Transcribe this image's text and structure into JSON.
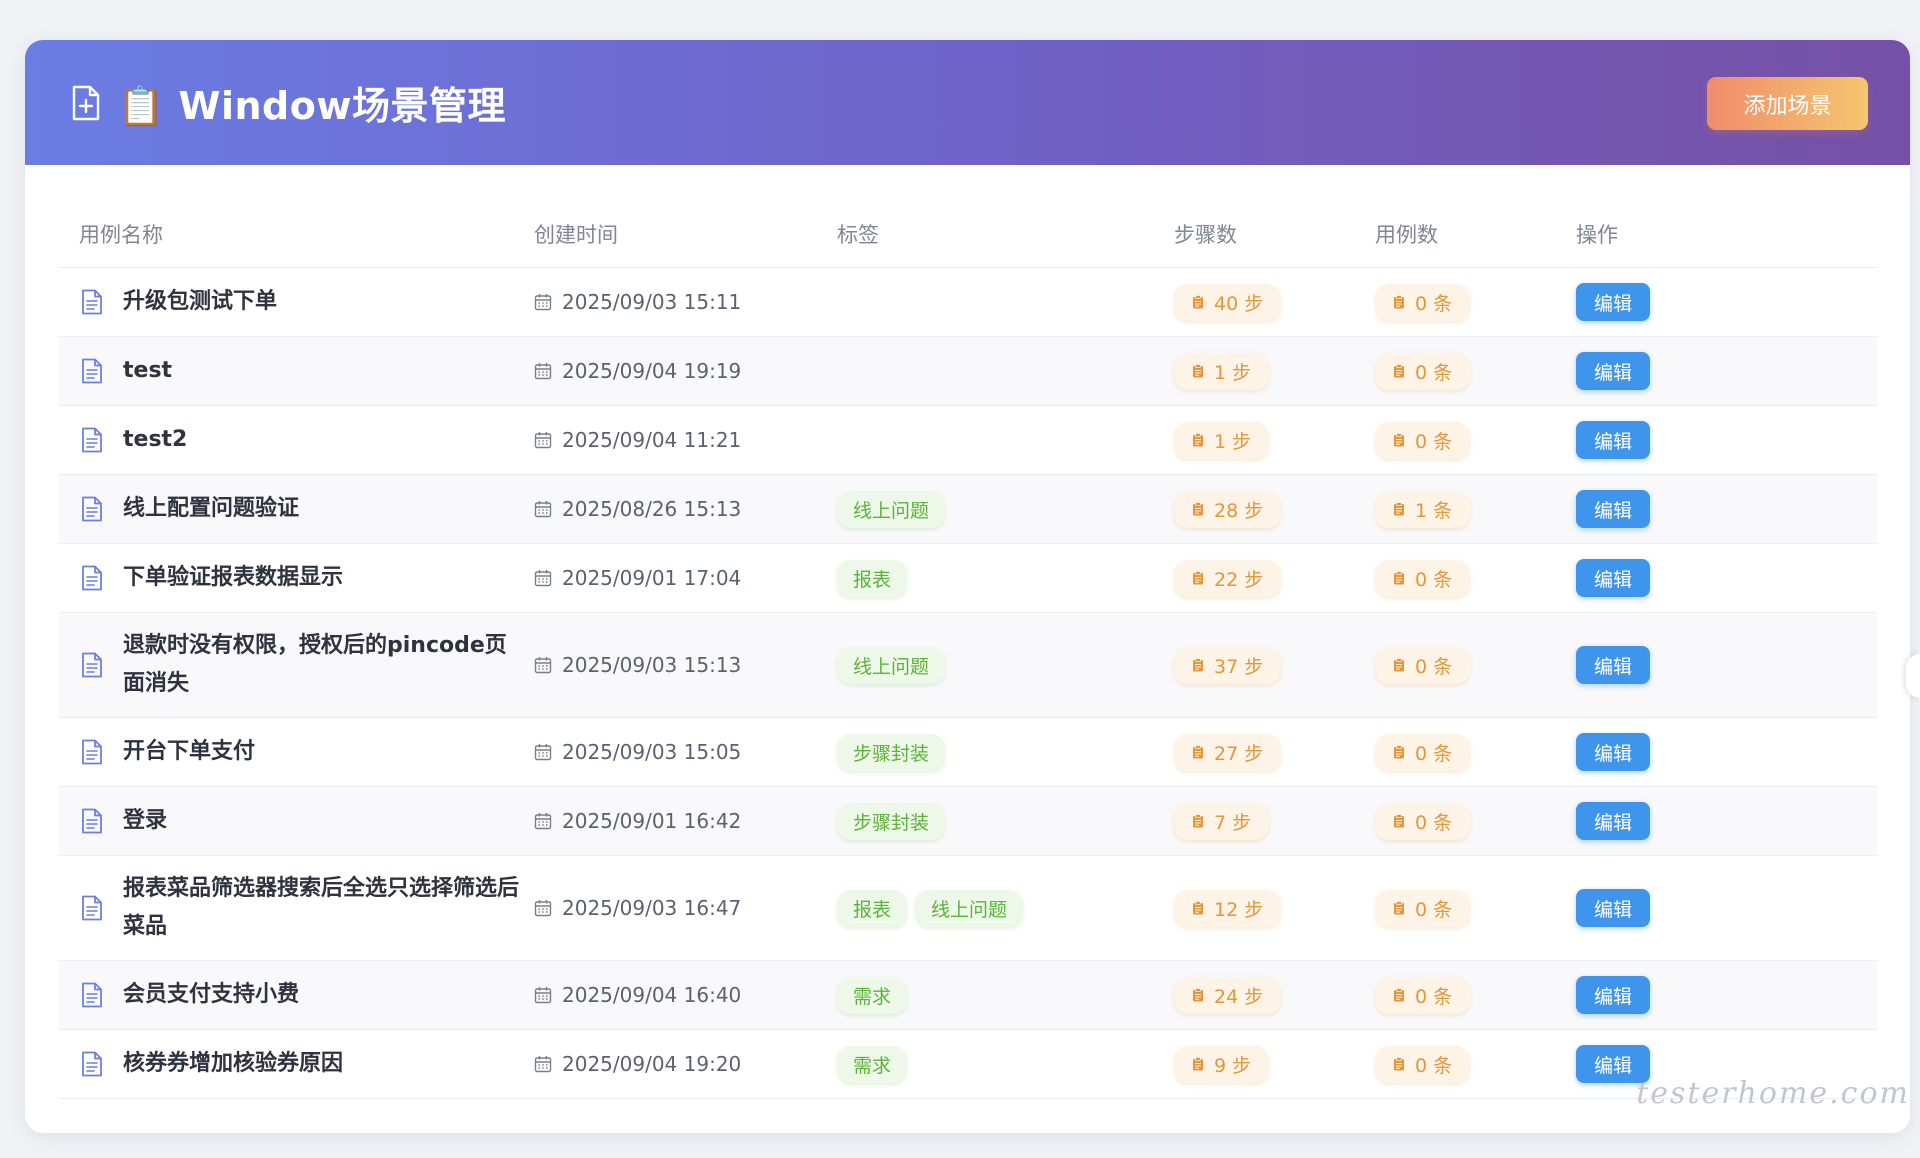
{
  "header": {
    "title": "📋 Window场景管理",
    "add_button_label": "添加场景"
  },
  "table": {
    "columns": [
      "用例名称",
      "创建时间",
      "标签",
      "步骤数",
      "用例数",
      "操作"
    ],
    "rows": [
      {
        "name": "升级包测试下单",
        "time": "2025/09/03 15:11",
        "tags": [],
        "steps": "40 步",
        "cases": "0 条",
        "action": "编辑"
      },
      {
        "name": "test",
        "time": "2025/09/04 19:19",
        "tags": [],
        "steps": "1 步",
        "cases": "0 条",
        "action": "编辑"
      },
      {
        "name": "test2",
        "time": "2025/09/04 11:21",
        "tags": [],
        "steps": "1 步",
        "cases": "0 条",
        "action": "编辑"
      },
      {
        "name": "线上配置问题验证",
        "time": "2025/08/26 15:13",
        "tags": [
          "线上问题"
        ],
        "steps": "28 步",
        "cases": "1 条",
        "action": "编辑"
      },
      {
        "name": "下单验证报表数据显示",
        "time": "2025/09/01 17:04",
        "tags": [
          "报表"
        ],
        "steps": "22 步",
        "cases": "0 条",
        "action": "编辑"
      },
      {
        "name": "退款时没有权限，授权后的pincode页面消失",
        "time": "2025/09/03 15:13",
        "tags": [
          "线上问题"
        ],
        "steps": "37 步",
        "cases": "0 条",
        "action": "编辑"
      },
      {
        "name": "开台下单支付",
        "time": "2025/09/03 15:05",
        "tags": [
          "步骤封装"
        ],
        "steps": "27 步",
        "cases": "0 条",
        "action": "编辑"
      },
      {
        "name": "登录",
        "time": "2025/09/01 16:42",
        "tags": [
          "步骤封装"
        ],
        "steps": "7 步",
        "cases": "0 条",
        "action": "编辑"
      },
      {
        "name": "报表菜品筛选器搜索后全选只选择筛选后菜品",
        "time": "2025/09/03 16:47",
        "tags": [
          "报表",
          "线上问题"
        ],
        "steps": "12 步",
        "cases": "0 条",
        "action": "编辑"
      },
      {
        "name": "会员支付支持小费",
        "time": "2025/09/04 16:40",
        "tags": [
          "需求"
        ],
        "steps": "24 步",
        "cases": "0 条",
        "action": "编辑"
      },
      {
        "name": "核券券增加核验券原因",
        "time": "2025/09/04 19:20",
        "tags": [
          "需求"
        ],
        "steps": "9 步",
        "cases": "0 条",
        "action": "编辑"
      }
    ]
  },
  "watermark": "testerhome.com",
  "colors": {
    "header_gradient_start": "#6a7de3",
    "header_gradient_end": "#7650a6",
    "add_button_start": "#f08c6c",
    "add_button_end": "#f5c66f",
    "tag_green": "#5ab43c",
    "count_orange": "#e4963a",
    "edit_blue": "#3f95ec",
    "doc_icon": "#6b7fe0"
  },
  "icons": {
    "header": "document-plus-icon",
    "row": "document-icon",
    "time": "calendar-icon",
    "count": "clipboard-icon"
  }
}
